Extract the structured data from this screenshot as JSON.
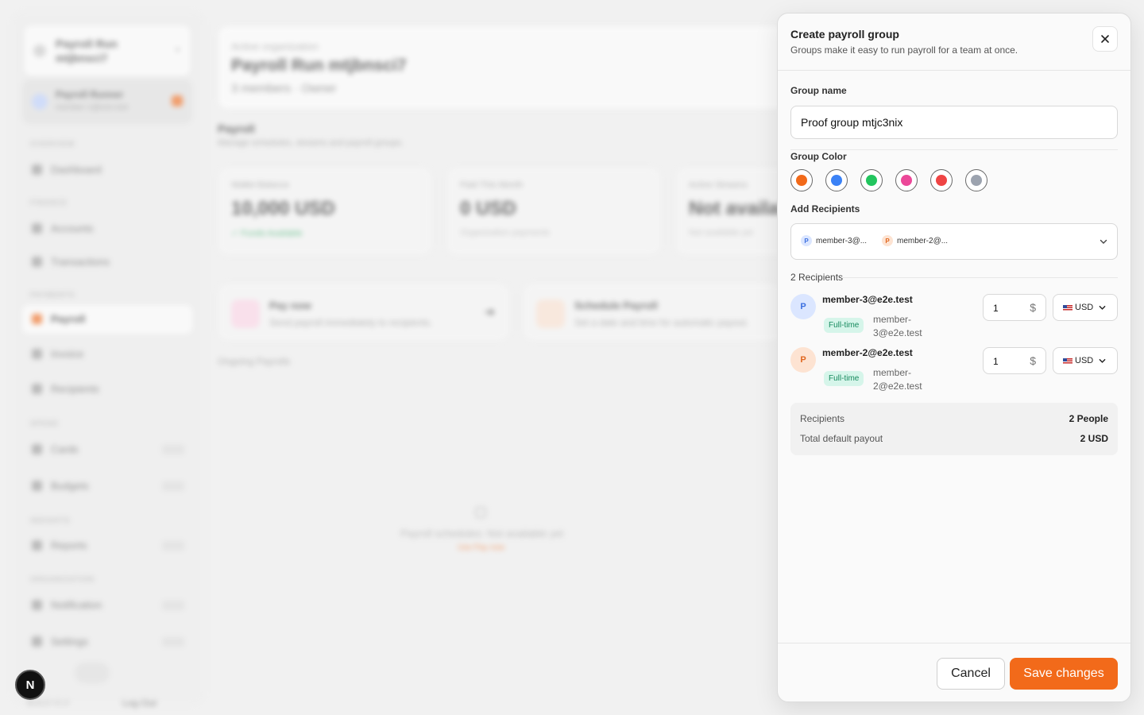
{
  "background": {
    "org_switcher": {
      "name": "Payroll Run mtjbnsci7"
    },
    "user": {
      "name": "Payroll Runner",
      "sub": "member-1@e2e.test"
    },
    "nav": {
      "overview": "OVERVIEW",
      "dashboard": "Dashboard",
      "finance": "FINANCE",
      "accounts": "Accounts",
      "transactions": "Transactions",
      "payments": "PAYMENTS",
      "payroll": "Payroll",
      "invoice": "Invoice",
      "recipients": "Recipients",
      "spend": "SPEND",
      "cards": "Cards",
      "budgets": "Budgets",
      "insights": "INSIGHTS",
      "reports": "Reports",
      "organization": "ORGANIZATION",
      "notification": "Notification",
      "settings": "Settings"
    },
    "footer": {
      "version": "BUILD V1.0",
      "logout": "Log Out"
    },
    "active_org": {
      "label": "Active organization",
      "name": "Payroll Run mtjbnsci7",
      "meta": "3 members · Owner"
    },
    "payroll": {
      "title": "Payroll",
      "subtitle": "Manage schedules, streams and payroll groups."
    },
    "stats": [
      {
        "label": "Wallet Balance",
        "value": "10,000 USD",
        "foot": "✓ Funds Available"
      },
      {
        "label": "Paid This Month",
        "value": "0 USD",
        "foot": "Organization payments"
      },
      {
        "label": "Active Streams",
        "value": "Not available",
        "foot": "Not available yet"
      }
    ],
    "actions": [
      {
        "title": "Pay now",
        "sub": "Send payroll immediately to recipients."
      },
      {
        "title": "Schedule Payroll",
        "sub": "Set a date and time for automatic payout."
      }
    ],
    "ongoing_label": "Ongoing Payrolls",
    "empty": {
      "text": "Payroll schedules: Not available yet",
      "link": "Use Pay now"
    }
  },
  "fab": {
    "label": "N"
  },
  "dialog": {
    "title": "Create payroll group",
    "subtitle": "Groups make it easy to run payroll for a team at once.",
    "group_name_label": "Group name",
    "group_name_value": "Proof group mtjc3nix",
    "group_color_label": "Group Color",
    "colors": [
      "#f26a1a",
      "#3b82f6",
      "#22c55e",
      "#ec4899",
      "#ef4444",
      "#9ca3af"
    ],
    "selected_color_index": 1,
    "add_recipients_label": "Add Recipients",
    "chips": [
      {
        "initial": "P",
        "label": "member-3@..."
      },
      {
        "initial": "P",
        "label": "member-2@..."
      }
    ],
    "recipients_count": "2 Recipients",
    "recipients": [
      {
        "initial": "P",
        "email": "member-3@e2e.test",
        "badge": "Full-time",
        "sub": "member-3@e2e.test",
        "amount": "1",
        "currency_symbol": "$",
        "currency": "USD"
      },
      {
        "initial": "P",
        "email": "member-2@e2e.test",
        "badge": "Full-time",
        "sub": "member-2@e2e.test",
        "amount": "1",
        "currency_symbol": "$",
        "currency": "USD"
      }
    ],
    "summary": {
      "recipients_label": "Recipients",
      "recipients_value": "2 People",
      "total_label": "Total default payout",
      "total_value": "2 USD"
    },
    "cancel_label": "Cancel",
    "save_label": "Save changes"
  }
}
